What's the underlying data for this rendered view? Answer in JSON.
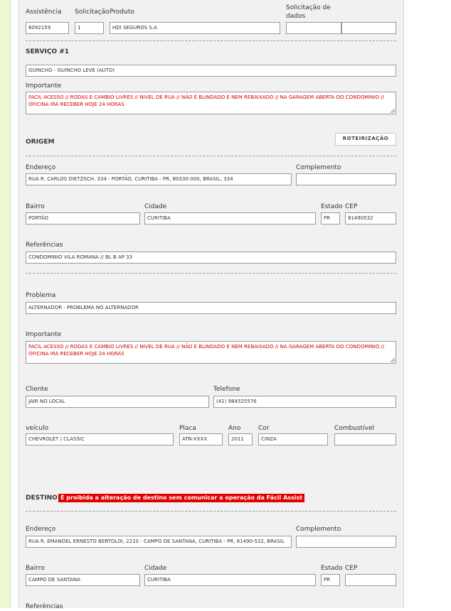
{
  "header": {
    "assistencia_label": "Assistência",
    "assistencia_value": "8092159",
    "solicitacao_label": "Solicitação",
    "solicitacao_value": "1",
    "produto_label": "Produto",
    "produto_value": "HDI SEGUROS S.A",
    "solicitacao_dados_label_1": "Solicitação de",
    "solicitacao_dados_label_2": "dados",
    "solicitacao_dados_value_1": "",
    "solicitacao_dados_value_2": ""
  },
  "servico": {
    "title": "SERVIÇO #1",
    "value": "GUINCHO - GUINCHO LEVE (AUTO)",
    "importante_label": "Importante",
    "importante_value": "FACIL ACESSO // RODAS E CAMBIO LIVRES // NIVEL DE RUA // NÃO É BLINDADO E NEM REBAIXADO // NA GARAGEM ABERTA DO CONDOMINIO // OFICINA IRÁ RECEBER HOJE 24 HORAS"
  },
  "origem": {
    "title": "ORIGEM",
    "roteirizacao_button": "ROTEIRIZAÇÃO",
    "endereco_label": "Endereço",
    "endereco_value": "RUA R. CARLOS DIETZSCH, 334 - PORTÃO, CURITIBA - PR, 80330-000, BRASIL, 334",
    "complemento_label": "Complemento",
    "complemento_value": "",
    "bairro_label": "Bairro",
    "bairro_value": "PORTÃO",
    "cidade_label": "Cidade",
    "cidade_value": "CURITIBA",
    "estado_label": "Estado",
    "estado_value": "PR",
    "cep_label": "CEP",
    "cep_value": "81490532",
    "referencias_label": "Referências",
    "referencias_value": "CONDOMINIO VILA ROMANA // BL B AP 33"
  },
  "problema": {
    "problema_label": "Problema",
    "problema_value": "ALTERNADOR - PROBLEMA NO ALTERNADOR",
    "importante_label": "Importante",
    "importante_value": "FACIL ACESSO // RODAS E CAMBIO LIVRES // NIVEL DE RUA // NÃO É BLINDADO E NEM REBAIXADO // NA GARAGEM ABERTA DO CONDOMINIO // OFICINA IRÁ RECEBER HOJE 24 HORAS",
    "cliente_label": "Cliente",
    "cliente_value": "JAIR NO LOCAL",
    "telefone_label": "Telefone",
    "telefone_value": "(41) 984525576",
    "veiculo_label": "veículo",
    "veiculo_value": "CHEVROLET / CLASSIC",
    "placa_label": "Placa",
    "placa_value": "ATN-XXXX",
    "ano_label": "Ano",
    "ano_value": "2011",
    "cor_label": "Cor",
    "cor_value": "CINZA",
    "combustivel_label": "Combustível",
    "combustivel_value": ""
  },
  "destino": {
    "title": "DESTINO",
    "warning": "É proibida a alteração de destino sem comunicar a operação da Fácil Assist",
    "endereco_label": "Endereço",
    "endereco_value": "RUA R. EMANOEL ERNESTO BERTOLDI, 2210 - CAMPO DE SANTANA, CURITIBA - PR, 81490-532, BRASIL",
    "complemento_label": "Complemento",
    "complemento_value": "",
    "bairro_label": "Bairro",
    "bairro_value": "CAMPO DE SANTANA",
    "cidade_label": "Cidade",
    "cidade_value": "CURITIBA",
    "estado_label": "Estado",
    "estado_value": "PR",
    "cep_label": "CEP",
    "cep_value": "",
    "referencias_label": "Referências"
  },
  "colors": {
    "panel_bg": "#f1f1f1",
    "sidebar_bg": "#eef8d3",
    "important_text": "#d40000",
    "warning_bg": "#e00000"
  }
}
